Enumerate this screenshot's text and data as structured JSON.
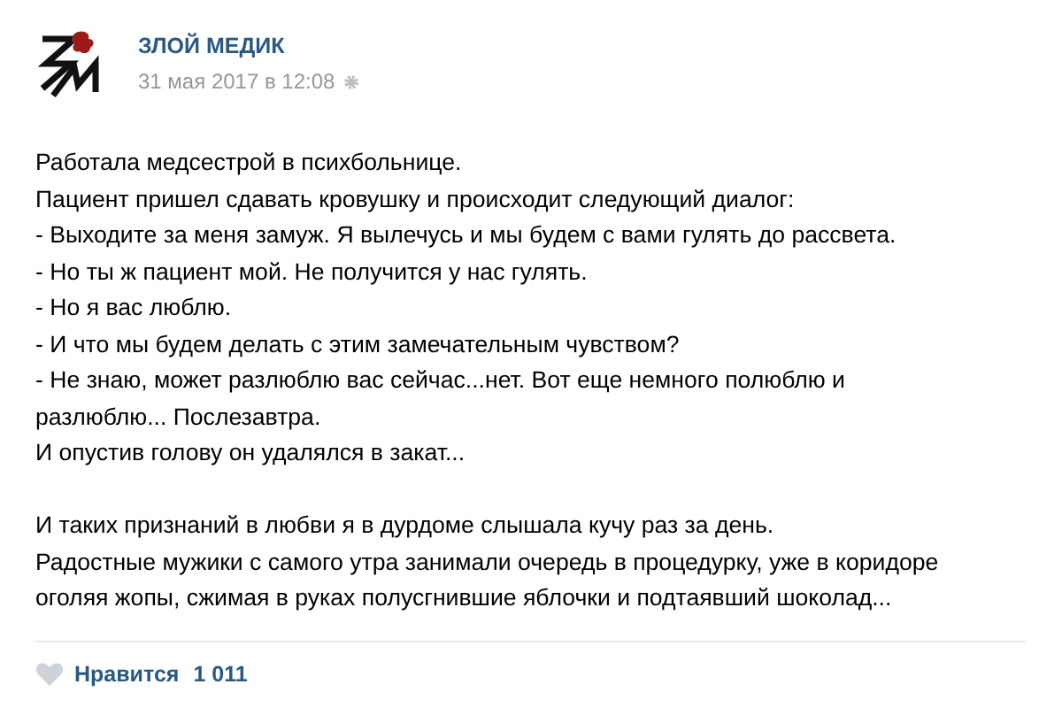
{
  "post": {
    "author": "ЗЛОЙ МЕДИК",
    "date": "31 мая 2017 в 12:08",
    "paragraphs": [
      [
        "Работала медсестрой в психбольнице.",
        "Пациент пришел сдавать кровушку и происходит следующий диалог:",
        "- Выходите за меня замуж. Я вылечусь и мы будем с вами гулять до рассвета.",
        "- Но ты ж пациент мой. Не получится у нас гулять.",
        "- Но я вас люблю.",
        "- И что мы будем делать с этим замечательным чувством?",
        "- Не знаю, может разлюблю вас сейчас...нет. Вот еще немного полюблю и",
        "разлюблю... Послезавтра.",
        "И опустив голову он удалялся в закат..."
      ],
      [
        "И таких признаний в любви я в дурдоме слышала кучу раз за день.",
        "Радостные мужики с самого утра занимали очередь в процедурку, уже в коридоре",
        "оголяя жопы, сжимая в руках полусгнившие яблочки и подтаявший шоколад..."
      ]
    ],
    "like": {
      "label": "Нравится",
      "count": "1 011",
      "selected": false
    }
  }
}
